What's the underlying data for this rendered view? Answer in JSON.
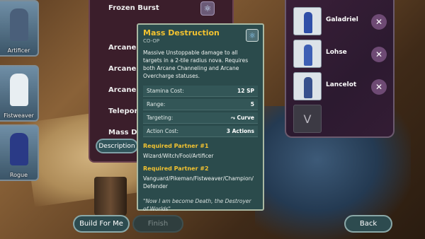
{
  "characters": [
    {
      "name": "Artificer",
      "color": "#4a5f7a"
    },
    {
      "name": "Fistweaver",
      "color": "#e8eef2"
    },
    {
      "name": "Rogue",
      "color": "#2a3a86"
    }
  ],
  "skill_list": {
    "items": [
      "Frozen Burst",
      "Arcane Co",
      "Arcane Ov",
      "Arcane Ba",
      "Teleportat",
      "Mass Dest"
    ],
    "description_button": "Description"
  },
  "detail": {
    "title": "Mass Destruction",
    "subtitle": "CO-OP",
    "description": "Massive Unstoppable damage to all targets in a 2-tile radius nova. Requires both Arcane Channeling and Arcane Overcharge statuses.",
    "stats": [
      {
        "label": "Stamina Cost:",
        "value": "12 SP"
      },
      {
        "label": "Range:",
        "value": "5"
      },
      {
        "label": "Targeting:",
        "value": "Curve"
      },
      {
        "label": "Action Cost:",
        "value": "3 Actions"
      }
    ],
    "partner1_heading": "Required Partner #1",
    "partner1_classes": "Wizard/Witch/Fool/Artificer",
    "partner2_heading": "Required Partner #2",
    "partner2_classes": "Vanguard/Pikeman/Fistweaver/Champion/ Defender",
    "quote": "\"Now I am become Death, the Destroyer of Worlds\""
  },
  "partners": [
    {
      "name": "Galadriel",
      "color": "#2f4fa8"
    },
    {
      "name": "Lohse",
      "color": "#3d5fb4"
    },
    {
      "name": "Lancelot",
      "color": "#37508c"
    }
  ],
  "more_slot_label": "V",
  "remove_symbol": "✕",
  "buttons": {
    "build": "Build For Me",
    "finish": "Finish",
    "back": "Back"
  }
}
